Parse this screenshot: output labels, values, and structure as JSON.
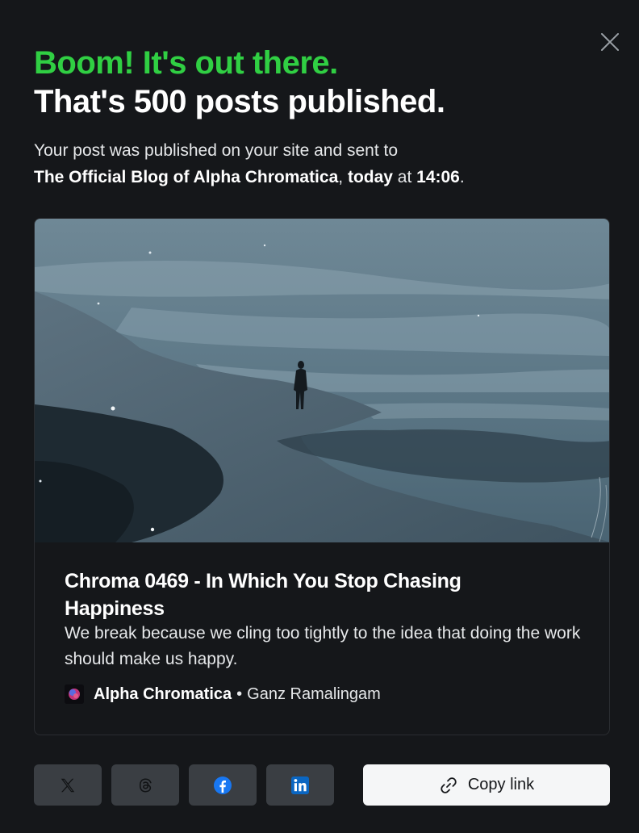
{
  "modal": {
    "headline_primary": "Boom! It's out there.",
    "headline_secondary": "That's 500 posts published.",
    "subtext": {
      "prefix": "Your post was published on your site and sent to",
      "newsletter": "The Official Blog of Alpha Chromatica",
      "comma": ",",
      "day": "today",
      "at": " at ",
      "time": "14:06",
      "period": "."
    },
    "close_icon": "close-icon"
  },
  "post_card": {
    "title": "Chroma 0469 - In Which You Stop Chasing Happiness",
    "excerpt": "We break because we cling too tightly to the idea that doing the work should make us happy.",
    "site_name": "Alpha Chromatica",
    "separator": "•",
    "author": "Ganz Ramalingam",
    "image_description_icon": "photo-lone-figure-on-beach"
  },
  "share": {
    "buttons": [
      {
        "icon": "x-twitter-icon"
      },
      {
        "icon": "threads-icon"
      },
      {
        "icon": "facebook-icon"
      },
      {
        "icon": "linkedin-icon"
      }
    ],
    "copy_label": "Copy link",
    "copy_icon": "link-icon"
  },
  "colors": {
    "accent_green": "#30cf43",
    "background": "#15171a",
    "facebook_blue": "#1877f2",
    "linkedin_blue": "#0a66c2"
  }
}
